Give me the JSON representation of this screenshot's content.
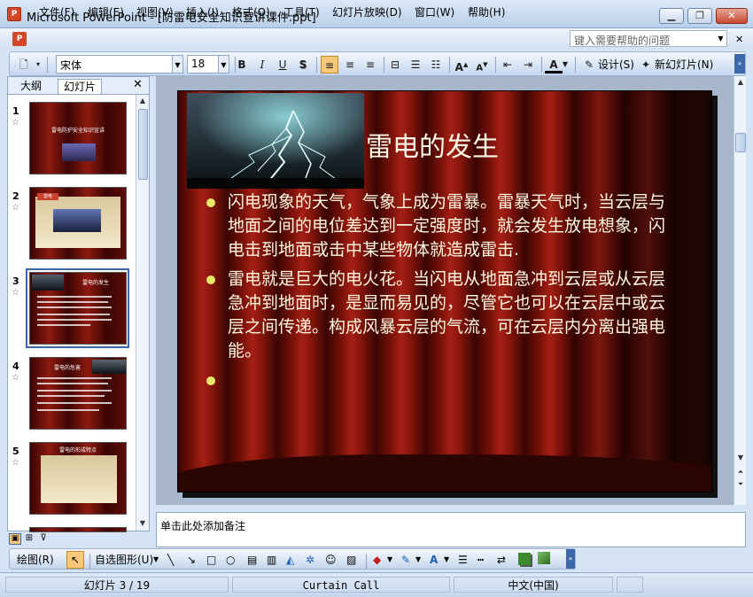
{
  "window": {
    "title": "Microsoft PowerPoint - [防雷电安全知识宣讲课件.ppt]",
    "app_icon_text": "P"
  },
  "menu": [
    "文件(F)",
    "编辑(E)",
    "视图(V)",
    "插入(I)",
    "格式(O)",
    "工具(T)",
    "幻灯片放映(D)",
    "窗口(W)",
    "帮助(H)"
  ],
  "help": {
    "placeholder": "键入需要帮助的问题"
  },
  "toolbar": {
    "font": "宋体",
    "size": "18",
    "design_label": "设计(S)",
    "new_slide_label": "新幻灯片(N)"
  },
  "panel": {
    "tab_outline": "大纲",
    "tab_slides": "幻灯片",
    "thumbnails": [
      {
        "num": "1",
        "title": "雷电防护安全知识宣讲"
      },
      {
        "num": "2",
        "title": "雷电"
      },
      {
        "num": "3",
        "title": "雷电的发生"
      },
      {
        "num": "4",
        "title": "雷电的危害"
      },
      {
        "num": "5",
        "title": "雷电的形成特点"
      }
    ]
  },
  "slide": {
    "title": "雷电的发生",
    "bullets": [
      "闪电现象的天气，气象上成为雷暴。雷暴天气时，当云层与地面之间的电位差达到一定强度时，就会发生放电想象，闪电击到地面或击中某些物体就造成雷击.",
      "雷电就是巨大的电火花。当闪电从地面急冲到云层或从云层急冲到地面时，是显而易见的，尽管它也可以在云层中或云层之间传递。构成风暴云层的气流，可在云层内分离出强电能。",
      ""
    ]
  },
  "notes": {
    "placeholder": "单击此处添加备注"
  },
  "drawing": {
    "draw_label": "绘图(R)",
    "autoshape_label": "自选图形(U)"
  },
  "status": {
    "slide": "幻灯片 3 / 19",
    "design": "Curtain Call",
    "language": "中文(中国)"
  }
}
